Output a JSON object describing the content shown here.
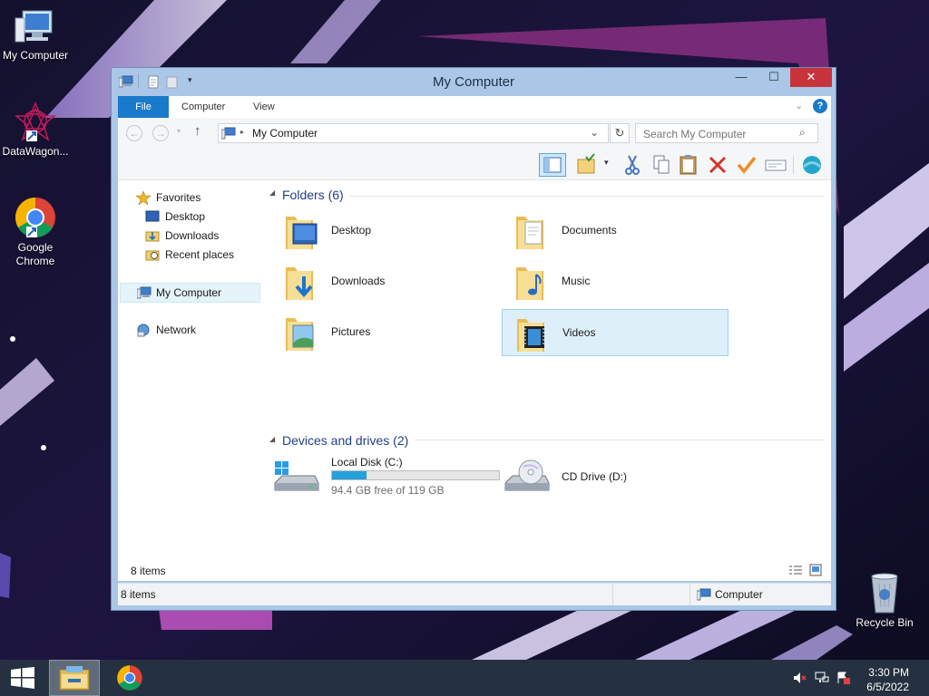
{
  "desktop": {
    "icons": [
      {
        "label": "My Computer"
      },
      {
        "label": "DataWagon..."
      },
      {
        "label": "Google Chrome"
      },
      {
        "label": "Recycle Bin"
      }
    ]
  },
  "window": {
    "title": "My Computer",
    "caption_buttons": {
      "minimize": "—",
      "maximize": "☐",
      "close": "✕"
    },
    "ribbon_tabs": [
      "File",
      "Computer",
      "View"
    ],
    "address": {
      "path": "My Computer"
    },
    "search": {
      "placeholder": "Search My Computer"
    },
    "nav": {
      "favorites_label": "Favorites",
      "favorites": [
        "Desktop",
        "Downloads",
        "Recent places"
      ],
      "computer": "My Computer",
      "network": "Network"
    },
    "groups": {
      "folders_title": "Folders (6)",
      "folders": [
        "Desktop",
        "Documents",
        "Downloads",
        "Music",
        "Pictures",
        "Videos"
      ],
      "devices_title": "Devices and drives (2)",
      "drive_c": {
        "label": "Local Disk (C:)",
        "free_text": "94.4 GB free of 119 GB",
        "used_fraction": 0.207
      },
      "drive_d": {
        "label": "CD Drive (D:)"
      }
    },
    "status_strip": "8 items",
    "status_bar": {
      "left": "8 items",
      "right": "Computer"
    }
  },
  "taskbar": {
    "clock_time": "3:30 PM",
    "clock_date": "6/5/2022"
  },
  "colors": {
    "accent": "#1979ca",
    "selection": "#ddf0fa",
    "progress": "#26a0da"
  }
}
